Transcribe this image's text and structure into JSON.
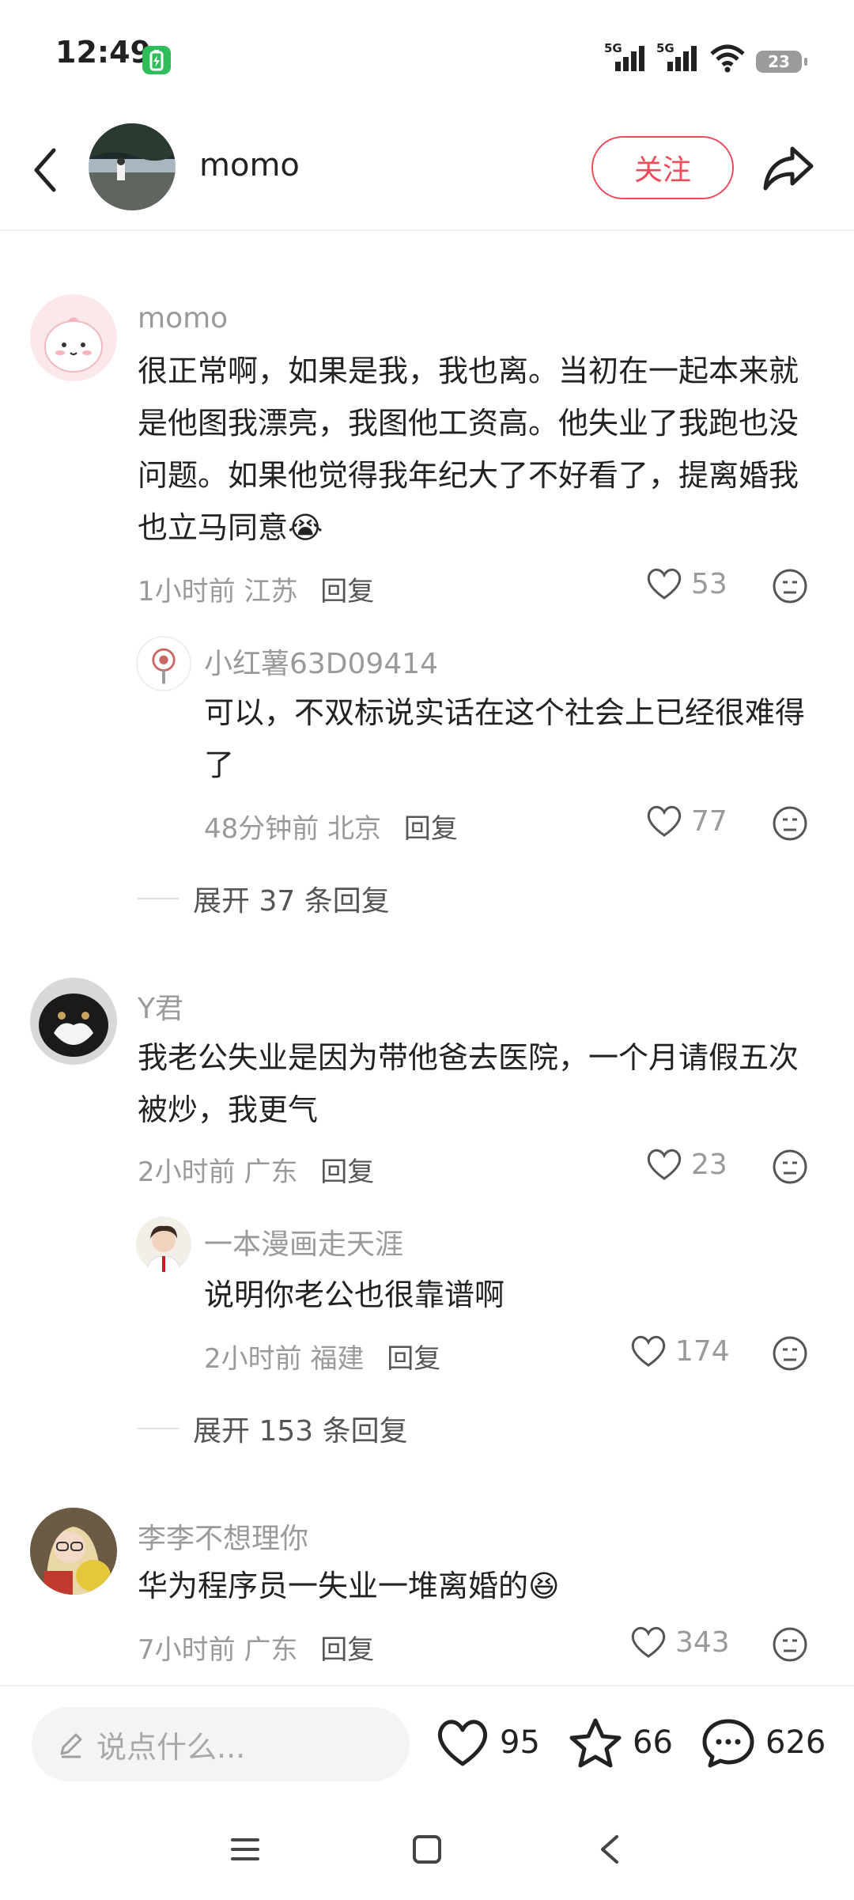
{
  "status_bar": {
    "time": "12:49",
    "battery": "23",
    "network_1": "5G",
    "network_2": "5G"
  },
  "header": {
    "author_name": "momo",
    "follow_label": "关注"
  },
  "comments": [
    {
      "user": "momo",
      "text": "很正常啊，如果是我，我也离。当初在一起本来就是他图我漂亮，我图他工资高。他失业了我跑也没问题。如果他觉得我年纪大了不好看了，提离婚我也立马同意😭",
      "time": "1小时前",
      "location": "江苏",
      "reply_label": "回复",
      "likes": "53",
      "replies": [
        {
          "user": "小红薯63D09414",
          "text": "可以，不双标说实话在这个社会上已经很难得了",
          "time": "48分钟前",
          "location": "北京",
          "reply_label": "回复",
          "likes": "77"
        }
      ],
      "expand_label": "展开 37 条回复"
    },
    {
      "user": "Y君",
      "text": "我老公失业是因为带他爸去医院，一个月请假五次被炒，我更气",
      "time": "2小时前",
      "location": "广东",
      "reply_label": "回复",
      "likes": "23",
      "replies": [
        {
          "user": "一本漫画走天涯",
          "text": "说明你老公也很靠谱啊",
          "time": "2小时前",
          "location": "福建",
          "reply_label": "回复",
          "likes": "174"
        }
      ],
      "expand_label": "展开 153 条回复"
    },
    {
      "user": "李李不想理你",
      "text": "华为程序员一失业一堆离婚的😆",
      "time": "7小时前",
      "location": "广东",
      "reply_label": "回复",
      "likes": "343"
    }
  ],
  "bottom_bar": {
    "input_placeholder": "说点什么...",
    "likes": "95",
    "favorites": "66",
    "comments": "626"
  },
  "colors": {
    "accent": "#f24a5b",
    "muted_text": "#9a9a9a"
  }
}
